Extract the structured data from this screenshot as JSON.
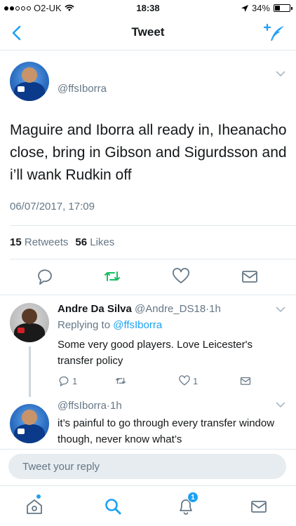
{
  "status_bar": {
    "carrier": "O2-UK",
    "time": "18:38",
    "battery": "34%",
    "battery_level": 0.34
  },
  "nav": {
    "title": "Tweet"
  },
  "main_tweet": {
    "handle": "@ffsIborra",
    "text": "Maguire and Iborra all ready in, Iheanacho close, bring in Gibson and Sigurdsson and i’ll wank Rudkin off",
    "timestamp": "06/07/2017, 17:09",
    "retweets_count": "15",
    "retweets_label": "Retweets",
    "likes_count": "56",
    "likes_label": "Likes"
  },
  "reply_tweet": {
    "name": "Andre Da Silva",
    "handle": "@Andre_DS18",
    "separator": "·",
    "age": "1h",
    "replying_to_label": "Replying to",
    "replying_to_handle": "@ffsIborra",
    "text": "Some very good players. Love Leicester's transfer policy",
    "reply_count": "1",
    "like_count": "1"
  },
  "third_tweet": {
    "handle": "@ffsIborra",
    "separator": "·",
    "age": "1h",
    "text": "it’s painful to go through every transfer window though, never know what’s"
  },
  "reply_bar": {
    "placeholder": "Tweet your reply"
  },
  "tab_bar": {
    "notifications_badge": "1"
  },
  "colors": {
    "accent": "#1da1f2",
    "retweet_green": "#17bf63",
    "secondary_text": "#657786"
  }
}
